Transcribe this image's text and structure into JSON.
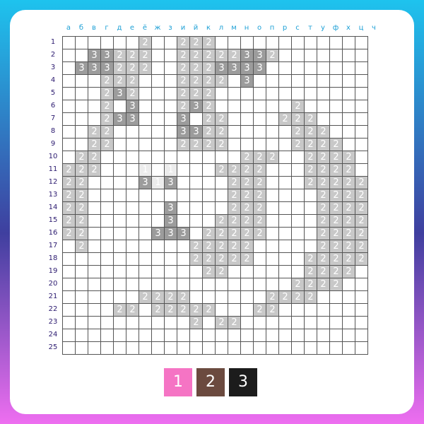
{
  "columns": [
    "а",
    "б",
    "в",
    "г",
    "д",
    "е",
    "ё",
    "ж",
    "з",
    "и",
    "й",
    "к",
    "л",
    "м",
    "н",
    "о",
    "п",
    "р",
    "с",
    "т",
    "у",
    "ф",
    "х",
    "ц",
    "ч"
  ],
  "rows": [
    "1",
    "2",
    "3",
    "4",
    "5",
    "6",
    "7",
    "8",
    "9",
    "10",
    "11",
    "12",
    "13",
    "14",
    "15",
    "16",
    "17",
    "18",
    "19",
    "20",
    "21",
    "22",
    "23",
    "24",
    "25"
  ],
  "grid": [
    "......2..222............",
    "..33222..22222332.......",
    ".333222..2223333........",
    "...222...2222.3.........",
    "...232...222............",
    "...2.3...232......2.....",
    "...233...3.22....222....",
    "..22.....3322.....222...",
    "..22.....2222.....2222..",
    ".22...........222..2222.",
    "222...1.1...2222...2222.",
    "22....313....222...22222",
    "22...........222....2222",
    "22......3....222....2222",
    "22......3...2222....2222",
    "22.....333.22222....2222",
    ".2........22222.....2222",
    "..........22222....22222",
    "...........22......2222.",
    "..................2222..",
    "......2222......2222....",
    "....22.22222...22.......",
    "..........2.22..........",
    "........................",
    "........................"
  ],
  "palette": [
    {
      "number": "1",
      "color": "#f574c4"
    },
    {
      "number": "2",
      "color": "#6b4a3f"
    },
    {
      "number": "3",
      "color": "#1c1c1c"
    }
  ]
}
